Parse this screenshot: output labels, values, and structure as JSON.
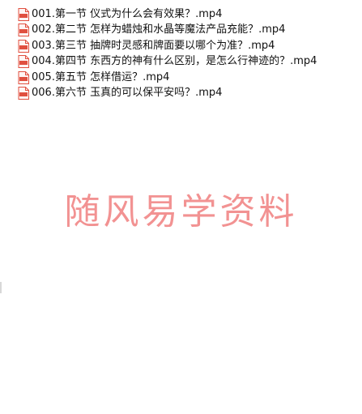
{
  "files": [
    {
      "name": "001.第一节 仪式为什么会有效果？.mp4",
      "icon": "video-file-icon"
    },
    {
      "name": "002.第二节  怎样为蜡烛和水晶等魔法产品充能？.mp4",
      "icon": "video-file-icon"
    },
    {
      "name": "003.第三节 抽牌时灵感和牌面要以哪个为准？.mp4",
      "icon": "video-file-icon"
    },
    {
      "name": "004.第四节 东西方的神有什么区别，是怎么行神迹的？.mp4",
      "icon": "video-file-icon"
    },
    {
      "name": "005.第五节 怎样借运？.mp4",
      "icon": "video-file-icon"
    },
    {
      "name": "006.第六节 玉真的可以保平安吗？.mp4",
      "icon": "video-file-icon"
    }
  ],
  "watermark": "随风易学资料",
  "colors": {
    "icon_red": "#e05040",
    "watermark": "#f08080",
    "text": "#111111"
  }
}
